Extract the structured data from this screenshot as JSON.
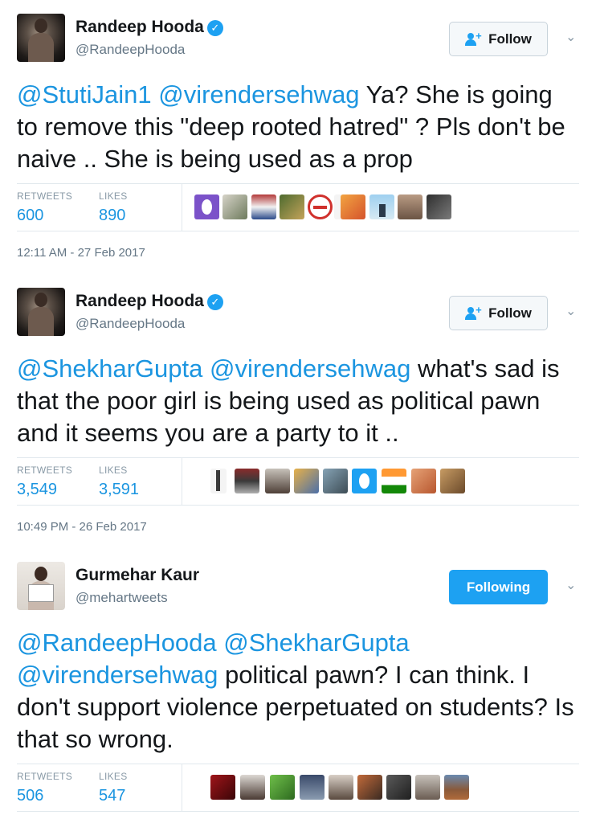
{
  "tweets": [
    {
      "name": "Randeep Hooda",
      "handle": "@RandeepHooda",
      "verified": true,
      "button_label": "Follow",
      "button_state": "follow",
      "mentions": [
        "@StutiJain1",
        "@virendersehwag"
      ],
      "body": "Ya? She is going to remove this \"deep rooted hatred\" ? Pls don't be naive .. She is being used as a prop",
      "retweets_label": "RETWEETS",
      "retweets": "600",
      "likes_label": "LIKES",
      "likes": "890",
      "timestamp": "12:11 AM - 27 Feb 2017"
    },
    {
      "name": "Randeep Hooda",
      "handle": "@RandeepHooda",
      "verified": true,
      "button_label": "Follow",
      "button_state": "follow",
      "mentions": [
        "@ShekharGupta",
        "@virendersehwag"
      ],
      "body": "what's sad is that the poor girl is being used as political pawn and it seems you are a party to it ..",
      "retweets_label": "RETWEETS",
      "retweets": "3,549",
      "likes_label": "LIKES",
      "likes": "3,591",
      "timestamp": "10:49 PM - 26 Feb 2017"
    },
    {
      "name": "Gurmehar Kaur",
      "handle": "@mehartweets",
      "verified": false,
      "button_label": "Following",
      "button_state": "following",
      "mentions": [
        "@RandeepHooda",
        "@ShekharGupta",
        "@virendersehwag"
      ],
      "body": "political pawn? I can think. I don't support violence perpetuated on students? Is that so wrong.",
      "retweets_label": "RETWEETS",
      "retweets": "506",
      "likes_label": "LIKES",
      "likes": "547"
    }
  ],
  "colors": {
    "accent": "#1da1f2",
    "mention": "#1b95e0",
    "muted": "#657786"
  }
}
